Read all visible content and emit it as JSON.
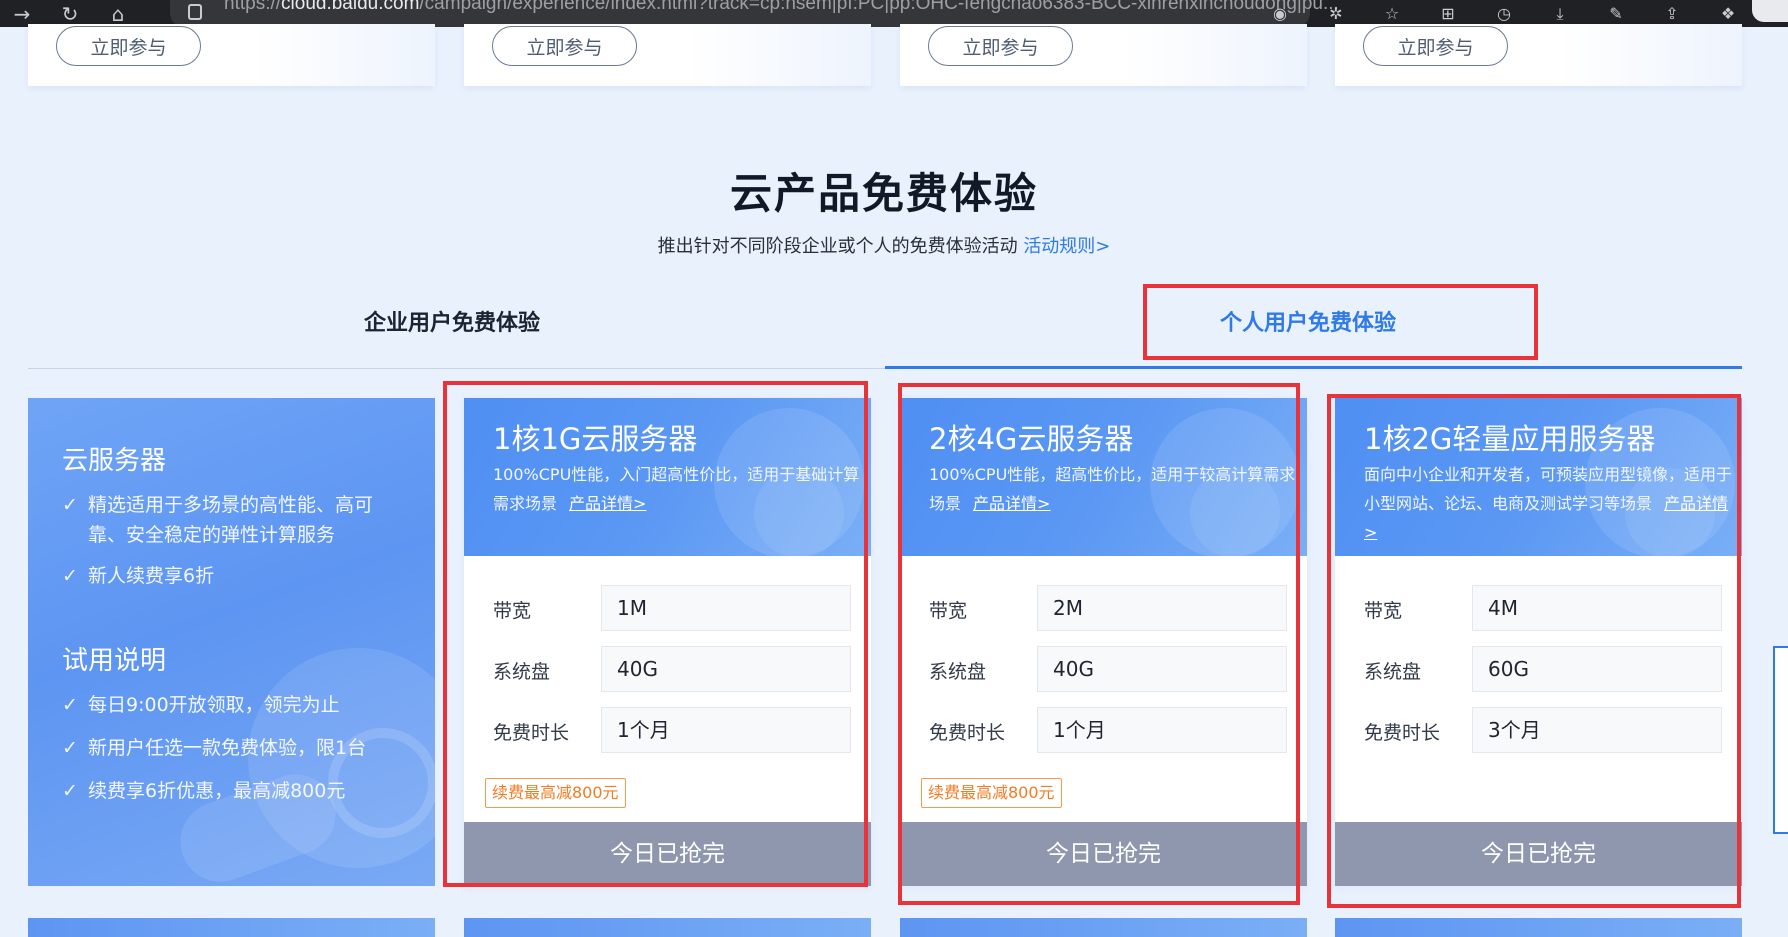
{
  "browser": {
    "url_prefix": "https://",
    "url_domain": "cloud.baidu.com",
    "url_rest": "/campaign/experience/index.html?track=cp:nsem|pf:PC|pp:OHC-fengchao6383-BCC-xinrenxinchoudong|pu..."
  },
  "top_cards": {
    "join_label": "立即参与"
  },
  "section": {
    "title": "云产品免费体验",
    "subtitle": "推出针对不同阶段企业或个人的免费体验活动",
    "rules_link": "活动规则>"
  },
  "tabs": {
    "enterprise": "企业用户免费体验",
    "personal": "个人用户免费体验",
    "active": "personal"
  },
  "intro": {
    "heading1": "云服务器",
    "features": [
      "精选适用于多场景的高性能、高可靠、安全稳定的弹性计算服务",
      "新人续费享6折"
    ],
    "heading2": "试用说明",
    "rules": [
      "每日9:00开放领取，领完为止",
      "新用户任选一款免费体验，限1台",
      "续费享6折优惠，最高减800元"
    ],
    "check_icon": "✓"
  },
  "spec_labels": {
    "bandwidth": "带宽",
    "disk": "系统盘",
    "duration": "免费时长"
  },
  "products": [
    {
      "title": "1核1G云服务器",
      "desc": "100%CPU性能，入门超高性价比，适用于基础计算需求场景",
      "detail_link": "产品详情>",
      "bandwidth": "1M",
      "disk": "40G",
      "duration": "1个月",
      "promo": "续费最高减800元",
      "button": "今日已抢完"
    },
    {
      "title": "2核4G云服务器",
      "desc": "100%CPU性能，超高性价比，适用于较高计算需求场景",
      "detail_link": "产品详情>",
      "bandwidth": "2M",
      "disk": "40G",
      "duration": "1个月",
      "promo": "续费最高减800元",
      "button": "今日已抢完"
    },
    {
      "title": "1核2G轻量应用服务器",
      "desc": "面向中小企业和开发者，可预装应用型镜像，适用于小型网站、论坛、电商及测试学习等场景",
      "detail_link": "产品详情>",
      "bandwidth": "4M",
      "disk": "60G",
      "duration": "3个月",
      "promo": "",
      "button": "今日已抢完"
    }
  ],
  "colors": {
    "accent": "#2f7ae5",
    "highlight_box": "#e8333b",
    "card_header": "#5b98f4",
    "soldout_button": "#8e97ad",
    "promo_tag": "#ef7d26"
  }
}
